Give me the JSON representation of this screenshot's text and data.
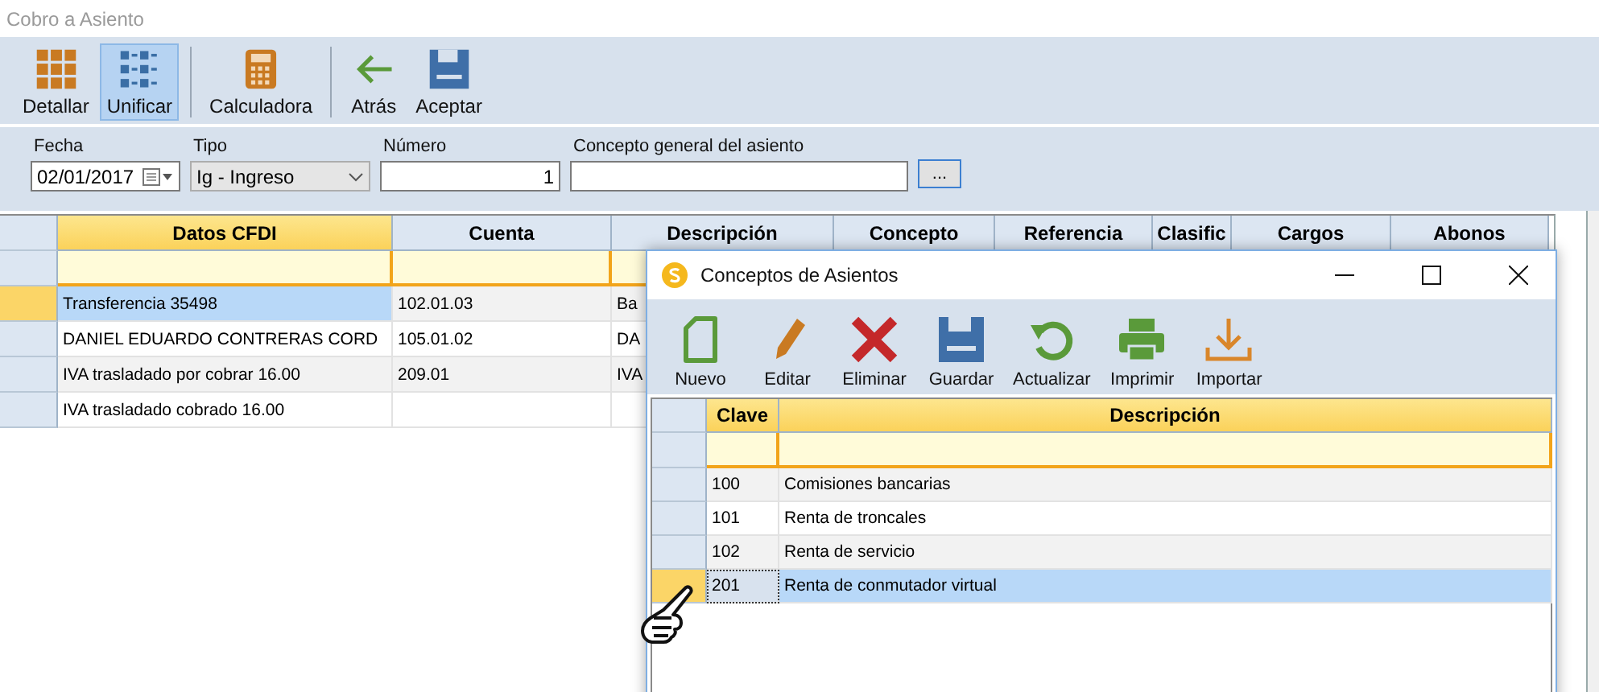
{
  "window": {
    "title": "Cobro a Asiento"
  },
  "toolbar": {
    "buttons": [
      {
        "label": "Detallar",
        "kind": "grid",
        "selected": false,
        "separator_before": false
      },
      {
        "label": "Unificar",
        "kind": "list",
        "selected": true,
        "separator_before": false
      },
      {
        "label": "Calculadora",
        "kind": "calculator",
        "selected": false,
        "separator_before": true
      },
      {
        "label": "Atrás",
        "kind": "back",
        "selected": false,
        "separator_before": true
      },
      {
        "label": "Aceptar",
        "kind": "save",
        "selected": false,
        "separator_before": false
      }
    ]
  },
  "form": {
    "fecha": {
      "label": "Fecha",
      "value": "02/01/2017"
    },
    "tipo": {
      "label": "Tipo",
      "value": "Ig - Ingreso"
    },
    "numero": {
      "label": "Número",
      "value": "1"
    },
    "concepto": {
      "label": "Concepto general del asiento",
      "button": "..."
    }
  },
  "table": {
    "columns": [
      {
        "label": "Datos CFDI",
        "selected": true
      },
      {
        "label": "Cuenta",
        "selected": false
      },
      {
        "label": "Descripción",
        "selected": false
      },
      {
        "label": "Concepto",
        "selected": false
      },
      {
        "label": "Referencia",
        "selected": false
      },
      {
        "label": "Clasific",
        "selected": false
      },
      {
        "label": "Cargos",
        "selected": false
      },
      {
        "label": "Abonos",
        "selected": false
      }
    ],
    "rows": [
      {
        "selected": true,
        "cells": [
          "Transferencia 35498",
          "102.01.03",
          "Ba"
        ]
      },
      {
        "selected": false,
        "cells": [
          "DANIEL EDUARDO CONTRERAS CORD",
          "105.01.02",
          "DA"
        ]
      },
      {
        "selected": false,
        "cells": [
          "IVA trasladado por cobrar 16.00",
          "209.01",
          "IVA"
        ]
      },
      {
        "selected": false,
        "cells": [
          "IVA trasladado cobrado 16.00"
        ]
      }
    ]
  },
  "dialog": {
    "title": "Conceptos de Asientos",
    "toolbar": {
      "buttons": [
        {
          "label": "Nuevo",
          "kind": "new"
        },
        {
          "label": "Editar",
          "kind": "edit"
        },
        {
          "label": "Eliminar",
          "kind": "delete"
        },
        {
          "label": "Guardar",
          "kind": "save"
        },
        {
          "label": "Actualizar",
          "kind": "refresh"
        },
        {
          "label": "Imprimir",
          "kind": "print"
        },
        {
          "label": "Importar",
          "kind": "import"
        }
      ]
    },
    "table": {
      "columns": [
        {
          "label": "Clave"
        },
        {
          "label": "Descripción"
        }
      ],
      "rows": [
        {
          "selected": false,
          "cells": [
            "100",
            "Comisiones bancarias"
          ]
        },
        {
          "selected": false,
          "cells": [
            "101",
            "Renta de troncales"
          ]
        },
        {
          "selected": false,
          "cells": [
            "102",
            "Renta de servicio"
          ]
        },
        {
          "selected": true,
          "cells": [
            "201",
            "Renta de conmutador virtual"
          ]
        }
      ]
    }
  }
}
